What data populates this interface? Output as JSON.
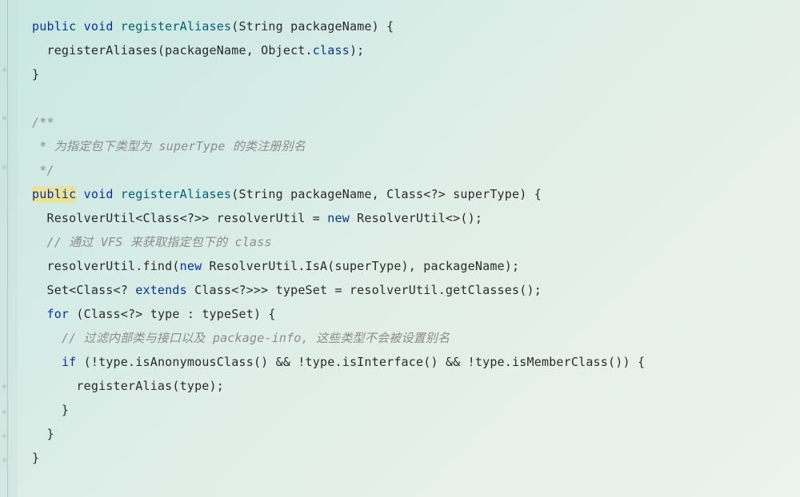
{
  "code": {
    "method1": {
      "keyword_public": "public",
      "keyword_void": "void",
      "method_name": "registerAliases",
      "params": "(String packageName) {",
      "body_line": "  registerAliases(packageName, Object.",
      "body_class": "class",
      "body_end": ");",
      "close": "}"
    },
    "javadoc": {
      "open": "/**",
      "line1": " * 为指定包下类型为 superType 的类注册别名",
      "close": " */"
    },
    "method2": {
      "keyword_public": "public",
      "keyword_void": " void ",
      "method_name": "registerAliases",
      "params": "(String packageName, Class<?> superType) {",
      "line1_a": "  ResolverUtil<Class<?>> resolverUtil = ",
      "line1_new": "new",
      "line1_b": " ResolverUtil<>();",
      "comment1": "  // 通过 VFS 来获取指定包下的 class",
      "line2_a": "  resolverUtil.find(",
      "line2_new": "new",
      "line2_b": " ResolverUtil.IsA(superType), packageName);",
      "line3_a": "  Set<Class<? ",
      "line3_extends": "extends",
      "line3_b": " Class<?>>> typeSet = resolverUtil.getClasses();",
      "for_kw": "for",
      "for_rest": " (Class<?> type : typeSet) {",
      "comment2": "    // 过滤内部类与接口以及 package-info, 这些类型不会被设置别名",
      "if_kw": "if",
      "if_rest": " (!type.isAnonymousClass() && !type.isInterface() && !type.isMemberClass()) {",
      "register_call": "      registerAlias(type);",
      "close_if": "    }",
      "close_for": "  }",
      "close_method": "}"
    }
  }
}
